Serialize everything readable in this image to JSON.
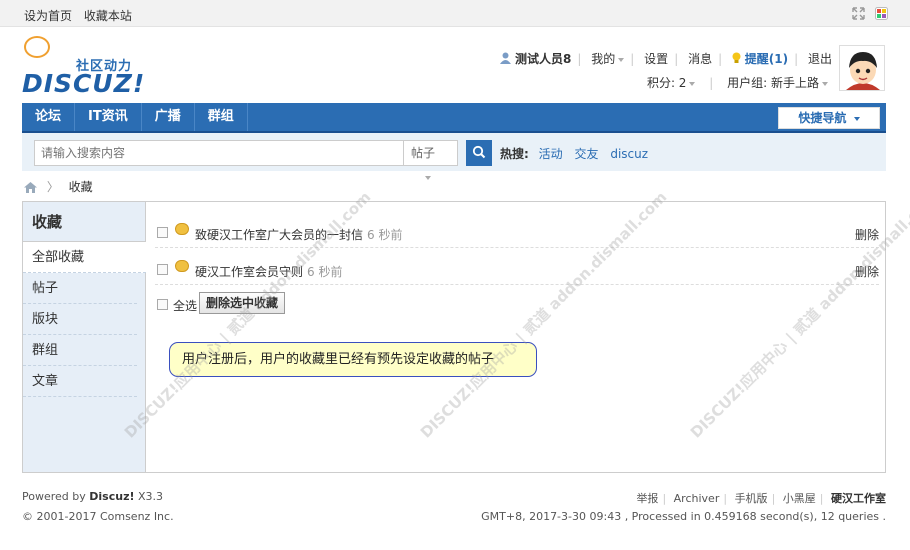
{
  "topbar": {
    "set_home": "设为首页",
    "bookmark": "收藏本站"
  },
  "logo": {
    "tagline": "社区动力",
    "wordmark": "DISCUZ!"
  },
  "userbar": {
    "username": "测试人员8",
    "mine": "我的",
    "settings": "设置",
    "messages": "消息",
    "remind": "提醒(1)",
    "logout": "退出",
    "points": "积分: 2",
    "usergroup": "用户组: 新手上路"
  },
  "nav": {
    "items": [
      "论坛",
      "IT资讯",
      "广播",
      "群组"
    ],
    "quick_nav": "快捷导航"
  },
  "search": {
    "placeholder": "请输入搜索内容",
    "type": "帖子",
    "hot_label": "热搜:",
    "hot_items": [
      "活动",
      "交友",
      "discuz"
    ]
  },
  "breadcrumb": {
    "current": "收藏"
  },
  "sidebar": {
    "title": "收藏",
    "items": [
      "全部收藏",
      "帖子",
      "版块",
      "群组",
      "文章"
    ]
  },
  "favorites": [
    {
      "title": "致硬汉工作室广大会员的一封信",
      "time": "6 秒前",
      "action": "删除"
    },
    {
      "title": "硬汉工作室会员守则",
      "time": "6 秒前",
      "action": "删除"
    }
  ],
  "actions": {
    "select_all": "全选",
    "delete_selected": "删除选中收藏"
  },
  "note": "用户注册后，用户的收藏里已经有预先设定收藏的帖子",
  "watermark": "DISCUZ!应用中心 | 贰道 addon.dismall.com",
  "footer": {
    "powered_prefix": "Powered by",
    "powered_brand": "Discuz!",
    "powered_version": "X3.3",
    "copyright": "© 2001-2017 Comsenz Inc.",
    "links": [
      "举报",
      "Archiver",
      "手机版",
      "小黑屋"
    ],
    "studio": "硬汉工作室",
    "stats": "GMT+8, 2017-3-30 09:43 , Processed in 0.459168 second(s), 12 queries ."
  },
  "colors": {
    "accent": "#2b6db3",
    "side_bg": "#e6eef7",
    "note_bg": "#ffffc8"
  }
}
